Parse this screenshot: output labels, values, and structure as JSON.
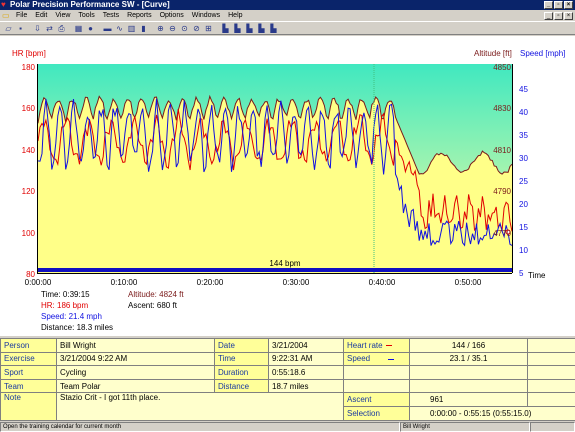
{
  "window": {
    "title": "Polar Precision Performance SW - [Curve]",
    "controls": [
      "_",
      "×",
      "×"
    ]
  },
  "menu": [
    "File",
    "Edit",
    "View",
    "Tools",
    "Tests",
    "Reports",
    "Options",
    "Windows",
    "Help"
  ],
  "chart": {
    "left_axis_title": "HR [bpm]",
    "altitude_axis_title": "Altitude [ft]",
    "speed_axis_title": "Speed [mph]",
    "hr_ticks": [
      "180",
      "160",
      "140",
      "120",
      "100",
      "80"
    ],
    "altitude_ticks": [
      "4850",
      "4830",
      "4810",
      "4790",
      "4770"
    ],
    "speed_ticks": [
      "45",
      "40",
      "35",
      "30",
      "25",
      "20",
      "15",
      "10",
      "5"
    ],
    "time_ticks": [
      "0:00:00",
      "0:10:00",
      "0:20:00",
      "0:30:00",
      "0:40:00",
      "0:50:00"
    ],
    "time_label": "Time",
    "threshold_label": "144 bpm",
    "colors": {
      "hr": "#e00000",
      "altitude": "#7a1a1a",
      "speed": "#1010e0",
      "altitude_fill": "#ffff88",
      "bg_top": "#40e8c0",
      "bg_bottom": "#ffffa0"
    }
  },
  "cursor_info": {
    "time": "Time: 0:39:15",
    "altitude": "Altitude: 4824 ft",
    "hr": "HR: 186 bpm",
    "ascent": "Ascent: 680 ft",
    "speed": "Speed: 21.4 mph",
    "distance": "Distance: 18.3 miles"
  },
  "table": {
    "person_label": "Person",
    "person": "Bill Wright",
    "date_label": "Date",
    "date": "3/21/2004",
    "hr_label": "Heart rate",
    "hr_value": "144 / 166",
    "exercise_label": "Exercise",
    "exercise": "3/21/2004 9:22 AM",
    "time_label": "Time",
    "time": "9:22:31 AM",
    "speed_label": "Speed",
    "speed_value": "23.1 / 35.1",
    "sport_label": "Sport",
    "sport": "Cycling",
    "duration_label": "Duration",
    "duration": "0:55:18.6",
    "team_label": "Team",
    "team": "Team Polar",
    "distance_label": "Distance",
    "distance": "18.7 miles",
    "note_label": "Note",
    "note": "Stazio Crit - I got 11th place.",
    "ascent_label": "Ascent",
    "ascent": "961",
    "selection_label": "Selection",
    "selection": "0:00:00 - 0:55:15 (0:55:15.0)"
  },
  "status": {
    "left": "Open the training calendar for current month",
    "right": "Bill Wright"
  }
}
